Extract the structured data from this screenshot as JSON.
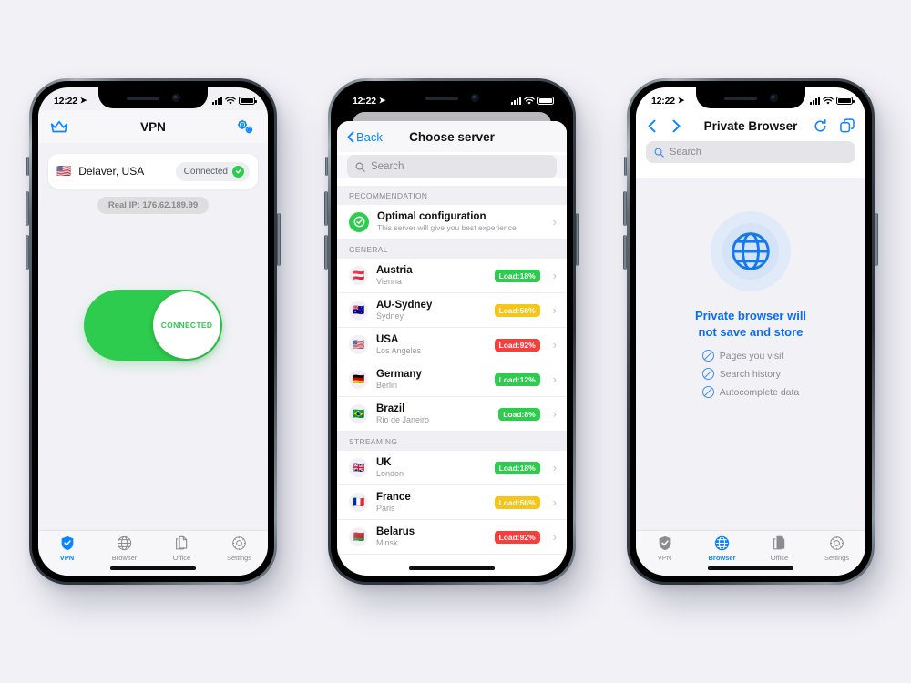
{
  "background_color": "#f2f1f6",
  "accent_blue": "#0a84ff",
  "accent_green": "#2ecc4e",
  "status_bar": {
    "time": "12:22",
    "location_arrow": "➤"
  },
  "tabs": [
    {
      "label": "VPN",
      "icon": "shield-check-icon"
    },
    {
      "label": "Browser",
      "icon": "globe-icon"
    },
    {
      "label": "Office",
      "icon": "documents-icon"
    },
    {
      "label": "Settings",
      "icon": "gear-icon"
    }
  ],
  "phone1": {
    "nav": {
      "title": "VPN",
      "left_icon": "crown-icon",
      "right_icon": "gears-icon"
    },
    "location_card": {
      "flag": "🇺🇸",
      "name": "Delaver, USA",
      "status_label": "Connected",
      "status_icon": "check-circle-icon"
    },
    "real_ip": "Real IP: 176.62.189.99",
    "toggle": {
      "state_label": "CONNECTED",
      "on": true
    },
    "active_tab": "VPN"
  },
  "phone2": {
    "nav": {
      "back_label": "Back",
      "title": "Choose server"
    },
    "search": {
      "placeholder": "Search",
      "value": ""
    },
    "sections": [
      {
        "label": "RECOMMENDATION",
        "rows": [
          {
            "icon": "check-shield-icon",
            "title": "Optimal configuration",
            "subtitle": "This server will give you best experience"
          }
        ]
      },
      {
        "label": "GENERAL",
        "rows": [
          {
            "flag": "🇦🇹",
            "title": "Austria",
            "subtitle": "Vienna",
            "load": "Load:18%",
            "load_color": "#2ecc4e"
          },
          {
            "flag": "🇦🇺",
            "title": "AU-Sydney",
            "subtitle": "Sydney",
            "load": "Load:56%",
            "load_color": "#f5c518"
          },
          {
            "flag": "🇺🇸",
            "title": "USA",
            "subtitle": "Los Angeles",
            "load": "Load:92%",
            "load_color": "#f43f3f"
          },
          {
            "flag": "🇩🇪",
            "title": "Germany",
            "subtitle": "Berlin",
            "load": "Load:12%",
            "load_color": "#2ecc4e"
          },
          {
            "flag": "🇧🇷",
            "title": "Brazil",
            "subtitle": "Rio de Janeiro",
            "load": "Load:8%",
            "load_color": "#2ecc4e"
          }
        ]
      },
      {
        "label": "STREAMING",
        "rows": [
          {
            "flag": "🇬🇧",
            "title": "UK",
            "subtitle": "London",
            "load": "Load:18%",
            "load_color": "#2ecc4e"
          },
          {
            "flag": "🇫🇷",
            "title": "France",
            "subtitle": "Paris",
            "load": "Load:56%",
            "load_color": "#f5c518"
          },
          {
            "flag": "🇧🇾",
            "title": "Belarus",
            "subtitle": "Minsk",
            "load": "Load:92%",
            "load_color": "#f43f3f"
          }
        ]
      }
    ]
  },
  "phone3": {
    "nav": {
      "title": "Private Browser",
      "back_icon": "chevron-left-icon",
      "forward_icon": "chevron-right-icon",
      "reload_icon": "reload-icon",
      "tabs_icon": "copy-tabs-icon"
    },
    "search": {
      "placeholder": "Search",
      "value": ""
    },
    "empty_state": {
      "icon": "globe-icon",
      "title_line1": "Private browser will",
      "title_line2": "not save and store",
      "items": [
        {
          "icon": "no-entry-icon",
          "label": "Pages you visit"
        },
        {
          "icon": "no-entry-icon",
          "label": "Search history"
        },
        {
          "icon": "no-entry-icon",
          "label": "Autocomplete data"
        }
      ]
    },
    "active_tab": "Browser"
  }
}
